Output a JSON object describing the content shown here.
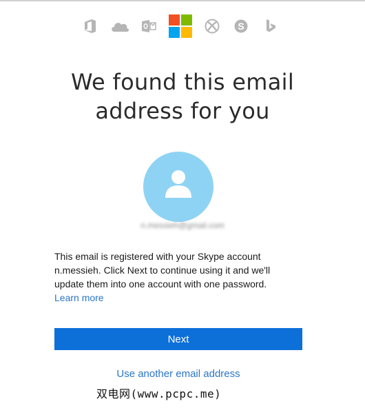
{
  "services": [
    {
      "icon": "office-icon"
    },
    {
      "icon": "onedrive-icon"
    },
    {
      "icon": "outlook-icon"
    },
    {
      "icon": "microsoft-logo-icon"
    },
    {
      "icon": "xbox-icon"
    },
    {
      "icon": "skype-icon"
    },
    {
      "icon": "bing-icon"
    }
  ],
  "colors": {
    "ms_red": "#f25022",
    "ms_green": "#7fba00",
    "ms_blue": "#00a4ef",
    "ms_yellow": "#ffb900",
    "accent": "#0d6fd8",
    "link": "#2a75c7",
    "avatar_bg": "#8fd3f4",
    "service_icon": "#b5b5b5"
  },
  "heading": {
    "line1": "We found this email",
    "line2": "address for you"
  },
  "account": {
    "email": "n.messieh@gmail.com"
  },
  "description": {
    "line1": "This email is registered with your Skype account",
    "line2": "n.messieh. Click Next to continue using it and we'll",
    "line3": "update them into one account with one password.",
    "learn_more": "Learn more"
  },
  "actions": {
    "next_label": "Next",
    "other_email_label": "Use another email address"
  },
  "watermark": "双电网(www.pcpc.me)"
}
